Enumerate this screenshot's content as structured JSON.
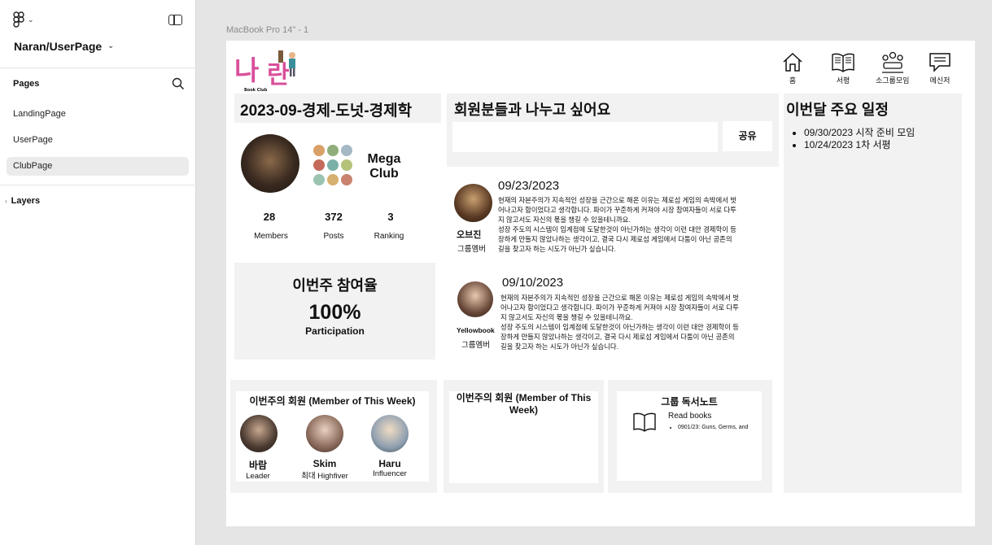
{
  "sidebar": {
    "project_title": "Naran/UserPage",
    "pages_label": "Pages",
    "pages": [
      {
        "label": "LandingPage",
        "active": false
      },
      {
        "label": "UserPage",
        "active": false
      },
      {
        "label": "ClubPage",
        "active": true
      }
    ],
    "layers_label": "Layers"
  },
  "canvas": {
    "frame_label": "MacBook Pro 14\" - 1"
  },
  "logo": {
    "title": "나란",
    "subtitle": "Book Club"
  },
  "nav": [
    {
      "label": "홈",
      "icon": "home-icon"
    },
    {
      "label": "서평",
      "icon": "book-open-icon"
    },
    {
      "label": "소그룹모임",
      "icon": "group-meeting-icon"
    },
    {
      "label": "메신저",
      "icon": "chat-icon"
    }
  ],
  "club": {
    "title": "2023-09-경제-도넛-경제학",
    "name_line1": "Mega",
    "name_line2": "Club",
    "stats": [
      {
        "value": "28",
        "label": "Members"
      },
      {
        "value": "372",
        "label": "Posts"
      },
      {
        "value": "3",
        "label": "Ranking"
      }
    ]
  },
  "participation": {
    "title": "이번주 참여율",
    "value": "100%",
    "label": "Participation",
    "level_percent": 100
  },
  "share": {
    "title": "회원분들과 나누고 싶어요",
    "input_value": "",
    "button": "공유"
  },
  "posts": [
    {
      "date": "09/23/2023",
      "author": "오브진",
      "role": "그룹멤버",
      "lines": [
        "현재의 자본주의가 지속적인 성장을 근간으로 해온 이유는 제로섬 게임의 속박에서 벗",
        "어나고자 함이었다고 생각합니다. 파이가 꾸준하게 커져야 시장 참여자들이 서로 다투",
        "지 않고서도 자신의 몫을 챙길 수 있을테니까요.",
        "성장 주도의 시스템이 임계점에 도달한것이 아닌가하는 생각이 이런 대안 경제학이 등",
        "장하게 만들지 않았나하는 생각이고, 결국 다시 제로섬 게임에서 다툼이 아닌 공존의",
        "길을 찾고자 하는 시도가 아닌가 싶습니다."
      ]
    },
    {
      "date": "09/10/2023",
      "author": "Yellowbook",
      "role": "그룹멤버",
      "lines": [
        "현재의 자본주의가 지속적인 성장을 근간으로 해온 이유는 제로섬 게임의 속박에서 벗",
        "어나고자 함이었다고 생각합니다. 파이가 꾸준하게 커져야 시장 참여자들이 서로 다투",
        "지 않고서도 자신의 몫을 챙길 수 있을테니까요.",
        "성장 주도의 시스템이 임계점에 도달한것이 아닌가하는 생각이 이런 대안 경제학이 등",
        "장하게 만들지 않았나하는 생각이고, 결국 다시 제로섬 게임에서 다툼이 아닌 공존의",
        "길을 찾고자 하는 시도가 아닌가 싶습니다."
      ]
    }
  ],
  "schedule": {
    "title": "이번달 주요 일정",
    "items": [
      "09/30/2023 시작 준비 모임",
      "10/24/2023 1차 서평"
    ]
  },
  "members_week": {
    "title": "이번주의 회원 (Member of This Week)",
    "members": [
      {
        "name": "바람",
        "role": "Leader"
      },
      {
        "name": "Skim",
        "role": "최대 Highfiver"
      },
      {
        "name": "Haru",
        "role": "Influencer"
      }
    ]
  },
  "members_week2": {
    "title_line1": "이번주의 회원 (Member of This",
    "title_line2": "Week)"
  },
  "reading_note": {
    "title": "그룹 독서노트",
    "label": "Read books",
    "items": [
      "0901/23: Guns, Germs, and"
    ]
  },
  "colors": {
    "panel": "#f2f2f2",
    "frame": "#ffffff",
    "canvas": "#e5e5e5",
    "logo_pink": "#d94f9b"
  }
}
